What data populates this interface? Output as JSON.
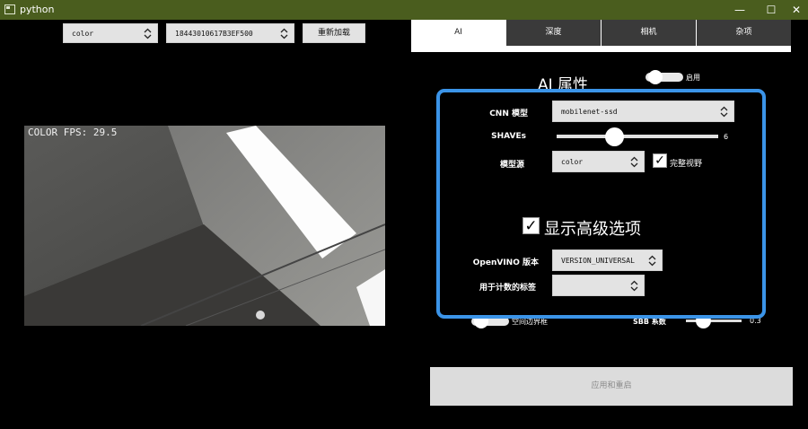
{
  "window": {
    "title": "python",
    "minimize": "—",
    "maximize": "☐",
    "close": "✕"
  },
  "top_controls": {
    "source_select": "color",
    "device_select": "18443010617B3EF500",
    "reload_button": "重新加载"
  },
  "preview": {
    "fps_label": "COLOR FPS: 29.5"
  },
  "tabs": [
    {
      "label": "AI",
      "active": true
    },
    {
      "label": "深度",
      "active": false
    },
    {
      "label": "相机",
      "active": false
    },
    {
      "label": "杂项",
      "active": false
    }
  ],
  "ai_panel": {
    "title": "AI 属性",
    "enable_label": "启用",
    "cnn_model_label": "CNN 模型",
    "cnn_model_value": "mobilenet-ssd",
    "shaves_label": "SHAVEs",
    "shaves_value": 6,
    "shaves_fraction": 0.36,
    "model_source_label": "模型源",
    "model_source_value": "color",
    "full_fov_label": "完整视野",
    "full_fov_checked": true,
    "advanced_label": "显示高级选项",
    "advanced_checked": true,
    "openvino_label": "OpenVINO 版本",
    "openvino_value": "VERSION_UNIVERSAL",
    "count_label": "用于计数的标签",
    "count_value": "",
    "spatial_bbox_label": "空间边界框",
    "sbb_label": "SBB 系数",
    "sbb_value": "0.3"
  },
  "apply_button": "应用和重启",
  "colors": {
    "titlebar": "#4a5d1e",
    "highlight": "#3b94e8"
  }
}
